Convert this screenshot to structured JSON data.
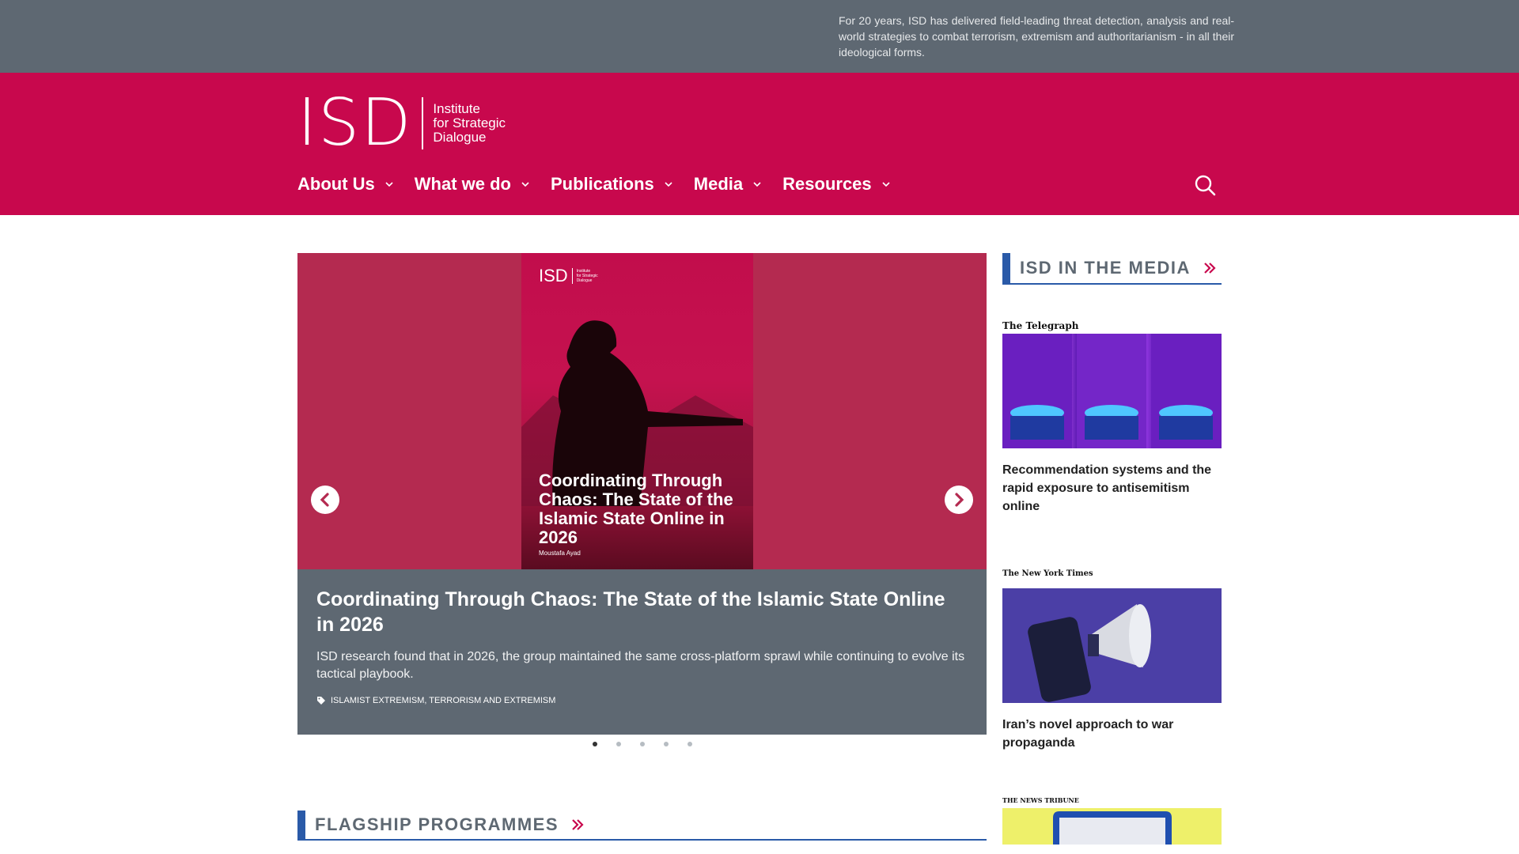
{
  "topbar": {
    "text": "For 20 years, ISD has delivered field-leading threat detection, analysis and real-world strategies to combat terrorism, extremism and authoritarianism - in all their ideological forms."
  },
  "logo": {
    "mark": "ISD",
    "line1": "Institute",
    "line2": "for Strategic",
    "line3": "Dialogue"
  },
  "nav": {
    "items": [
      {
        "label": "About Us"
      },
      {
        "label": "What we do"
      },
      {
        "label": "Publications"
      },
      {
        "label": "Media"
      },
      {
        "label": "Resources"
      }
    ]
  },
  "carousel": {
    "cover": {
      "logo": "ISD",
      "mini_line1": "Institute",
      "mini_line2": "for Strategic",
      "mini_line3": "Dialogue",
      "title": "Coordinating Through Chaos: The State of the Islamic State Online in 2026",
      "author": "Moustafa Ayad"
    },
    "title": "Coordinating Through Chaos: The State of the Islamic State Online in 2026",
    "description": "ISD research found that in 2026, the group maintained the same cross-platform sprawl while continuing to evolve its tactical playbook.",
    "tags": "ISLAMIST EXTREMISM, TERRORISM AND EXTREMISM",
    "active_index": 0
  },
  "media_section": {
    "label": "ISD IN THE MEDIA",
    "cards": [
      {
        "publication": "The Telegraph",
        "title": "Recommendation systems and the rapid exposure to antisemitism online"
      },
      {
        "publication": "The New York Times",
        "title": "Iran’s novel approach to war propaganda"
      },
      {
        "publication": "THE NEWS TRIBUNE",
        "title": ""
      }
    ]
  },
  "flagship_section": {
    "label": "FLAGSHIP PROGRAMMES"
  },
  "colors": {
    "brand": "#c8084d",
    "topbar": "#5e6872",
    "accent_blue": "#2a5aa8"
  }
}
